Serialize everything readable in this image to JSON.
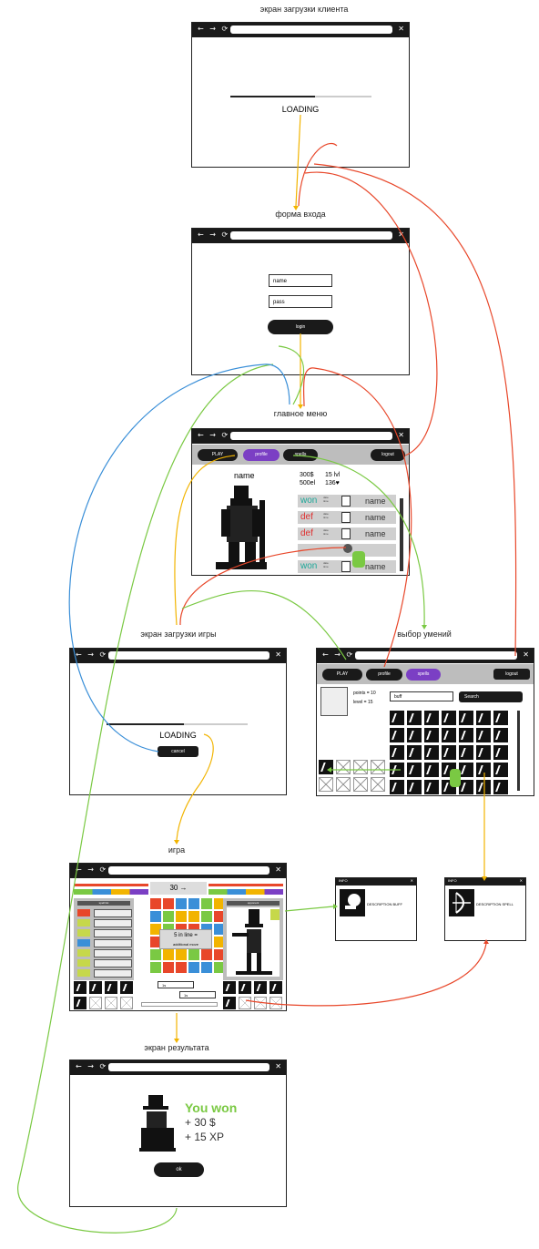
{
  "captions": {
    "client_loading": "экран загрузки клиента",
    "login_form": "форма входа",
    "main_menu": "главное меню",
    "game_loading": "экран загрузки игры",
    "skill_select": "выбор умений",
    "game": "игра",
    "result": "экран результата"
  },
  "client_loading": {
    "text": "LOADING",
    "progress": 0.6
  },
  "login": {
    "name_placeholder": "name",
    "pass_placeholder": "pass",
    "button": "login"
  },
  "main_menu": {
    "btn_play": "PLAY",
    "tab_profile": "profile",
    "tab_spells": "spells",
    "btn_logout": "logout",
    "player_name": "name",
    "stats": [
      "300$",
      "15 lvl",
      "500el",
      "136♥"
    ],
    "history": [
      {
        "result": "won",
        "detail": "date time",
        "name": "name",
        "color": "#1fa89a"
      },
      {
        "result": "def",
        "detail": "date time",
        "name": "name",
        "color": "#e03030"
      },
      {
        "result": "def",
        "detail": "date time",
        "name": "name",
        "color": "#e03030"
      },
      {
        "result": "",
        "detail": "",
        "name": "",
        "color": "#333"
      },
      {
        "result": "won",
        "detail": "date time",
        "name": "name",
        "color": "#1fa89a"
      }
    ]
  },
  "game_loading": {
    "text": "LOADING",
    "cancel": "cancel",
    "progress": 0.55
  },
  "skills": {
    "btn_play": "PLAY",
    "tab_profile": "profile",
    "tab_spells": "spells",
    "btn_logout": "logout",
    "points": "points = 10",
    "level": "level = 15",
    "filter": "buff",
    "search": "Search"
  },
  "game": {
    "turn": "30 →",
    "line_text": "5 in line =",
    "line_sub": "additional move",
    "left_head": "spell list",
    "right_head": "opponent",
    "input_a": "1s",
    "input_b": "1s"
  },
  "info_buff": {
    "title": "INFO",
    "text": "DESCRIPTION BUFF"
  },
  "info_spell": {
    "title": "INFO",
    "text": "DESCRIPTION SPELL"
  },
  "result": {
    "title": "You won",
    "money": "+ 30 $",
    "xp": "+ 15 XP",
    "button": "ok"
  },
  "colors": {
    "orange": "#f2b400",
    "red": "#e8472a",
    "green": "#7ac943",
    "blue": "#3a8fd8",
    "purple": "#7b3fc4",
    "win": "#7ac943"
  }
}
